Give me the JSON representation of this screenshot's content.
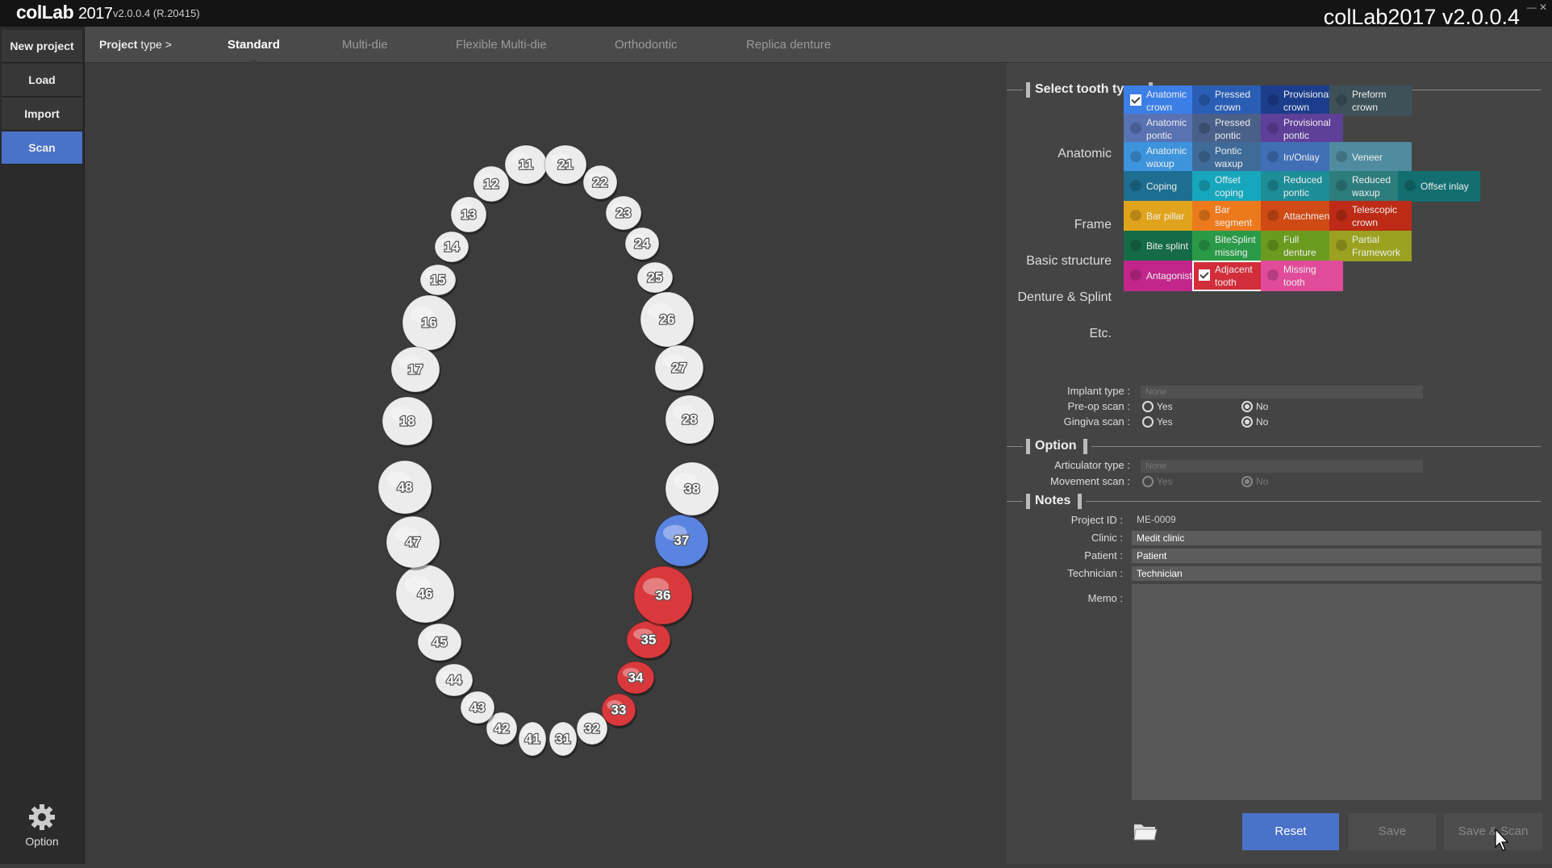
{
  "titlebar": {
    "brand": "colLab",
    "brand_year": "2017",
    "version_small": "v2.0.0.4  (R.20415)",
    "version_large": "colLab2017 v2.0.0.4",
    "controls": "— ✕"
  },
  "sidebar": {
    "new_project": "New project",
    "load": "Load",
    "import": "Import",
    "scan": "Scan",
    "option": "Option"
  },
  "tabs": {
    "project_type_bold": "Project",
    "project_type_rest": " type >",
    "items": [
      "Standard",
      "Multi-die",
      "Flexible Multi-die",
      "Orthodontic",
      "Replica denture"
    ],
    "active": "Standard"
  },
  "teeth": [
    {
      "num": "11",
      "state": "default"
    },
    {
      "num": "12",
      "state": "default"
    },
    {
      "num": "13",
      "state": "default"
    },
    {
      "num": "14",
      "state": "default"
    },
    {
      "num": "15",
      "state": "default"
    },
    {
      "num": "16",
      "state": "default"
    },
    {
      "num": "17",
      "state": "default"
    },
    {
      "num": "18",
      "state": "default"
    },
    {
      "num": "21",
      "state": "default"
    },
    {
      "num": "22",
      "state": "default"
    },
    {
      "num": "23",
      "state": "default"
    },
    {
      "num": "24",
      "state": "default"
    },
    {
      "num": "25",
      "state": "default"
    },
    {
      "num": "26",
      "state": "default"
    },
    {
      "num": "27",
      "state": "default"
    },
    {
      "num": "28",
      "state": "default"
    },
    {
      "num": "31",
      "state": "default"
    },
    {
      "num": "32",
      "state": "default"
    },
    {
      "num": "33",
      "state": "adjacent"
    },
    {
      "num": "34",
      "state": "adjacent"
    },
    {
      "num": "35",
      "state": "adjacent"
    },
    {
      "num": "36",
      "state": "adjacent"
    },
    {
      "num": "37",
      "state": "crown"
    },
    {
      "num": "38",
      "state": "default"
    },
    {
      "num": "41",
      "state": "default"
    },
    {
      "num": "42",
      "state": "default"
    },
    {
      "num": "43",
      "state": "default"
    },
    {
      "num": "44",
      "state": "default"
    },
    {
      "num": "45",
      "state": "default"
    },
    {
      "num": "46",
      "state": "default"
    },
    {
      "num": "47",
      "state": "default"
    },
    {
      "num": "48",
      "state": "default"
    }
  ],
  "tooth_colors": {
    "default": "#ececec",
    "crown": "#5b84e0",
    "adjacent": "#d9393c"
  },
  "select_tooth_type": {
    "title": "Select tooth type",
    "rows": [
      {
        "label": "Anatomic",
        "buttons": [
          {
            "l1": "Anatomic",
            "l2": "crown",
            "color": "#3b7fe6",
            "checked": true
          },
          {
            "l1": "Pressed",
            "l2": "crown",
            "color": "#2a5eb5",
            "checked": false
          },
          {
            "l1": "Provisional",
            "l2": "crown",
            "color": "#1c3d8c",
            "checked": false
          },
          {
            "l1": "Preform",
            "l2": "crown",
            "color": "#3e5159",
            "checked": false
          },
          {
            "l1": "Anatomic",
            "l2": "pontic",
            "color": "#5872b2",
            "checked": false
          },
          {
            "l1": "Pressed",
            "l2": "pontic",
            "color": "#4a6088",
            "checked": false
          },
          {
            "l1": "Provisional",
            "l2": "pontic",
            "color": "#5e4098",
            "checked": false
          },
          {
            "l1": "Anatomic",
            "l2": "waxup",
            "color": "#3d94dc",
            "checked": false
          },
          {
            "l1": "Pontic",
            "l2": "waxup",
            "color": "#3f6b99",
            "checked": false
          },
          {
            "l1": "In/Onlay",
            "l2": "",
            "color": "#406fb6",
            "checked": false
          },
          {
            "l1": "Veneer",
            "l2": "",
            "color": "#4f8c9f",
            "checked": false
          }
        ]
      },
      {
        "label": "Frame",
        "buttons": [
          {
            "l1": "Coping",
            "l2": "",
            "color": "#1d6e90",
            "checked": false
          },
          {
            "l1": "Offset",
            "l2": "coping",
            "color": "#16a7bc",
            "checked": false
          },
          {
            "l1": "Reduced",
            "l2": "pontic",
            "color": "#1d8d98",
            "checked": false
          },
          {
            "l1": "Reduced",
            "l2": "waxup",
            "color": "#2e7d7d",
            "checked": false
          },
          {
            "l1": "Offset inlay",
            "l2": "",
            "color": "#136e70",
            "checked": false
          }
        ]
      },
      {
        "label": "Basic structure",
        "buttons": [
          {
            "l1": "Bar pillar",
            "l2": "",
            "color": "#e0a41c",
            "checked": false
          },
          {
            "l1": "Bar",
            "l2": "segment",
            "color": "#ec7a1c",
            "checked": false
          },
          {
            "l1": "Attachment",
            "l2": "",
            "color": "#cf4a15",
            "checked": false
          },
          {
            "l1": "Telescopic",
            "l2": "crown",
            "color": "#bd2b16",
            "checked": false
          }
        ]
      },
      {
        "label": "Denture & Splint",
        "buttons": [
          {
            "l1": "Bite splint",
            "l2": "",
            "color": "#156b46",
            "checked": false
          },
          {
            "l1": "BiteSplint",
            "l2": "missing",
            "color": "#2b9a48",
            "checked": false
          },
          {
            "l1": "Full",
            "l2": "denture",
            "color": "#6a9b1f",
            "checked": false
          },
          {
            "l1": "Partial",
            "l2": "Framework",
            "color": "#9aa220",
            "checked": false
          }
        ]
      },
      {
        "label": "Etc.",
        "buttons": [
          {
            "l1": "Antagonist",
            "l2": "",
            "color": "#c2268a",
            "checked": false
          },
          {
            "l1": "Adjacent",
            "l2": "tooth",
            "color": "#d12d3a",
            "checked": true
          },
          {
            "l1": "Missing",
            "l2": "tooth",
            "color": "#e04b9a",
            "checked": false
          }
        ]
      }
    ]
  },
  "implant": {
    "type_label": "Implant type :",
    "type_value": "None"
  },
  "preop": {
    "label": "Pre-op scan :",
    "yes": "Yes",
    "no": "No",
    "selected": "No"
  },
  "gingiva": {
    "label": "Gingiva scan :",
    "yes": "Yes",
    "no": "No",
    "selected": "No"
  },
  "option_section": {
    "title": "Option",
    "articulator_label": "Articulator type :",
    "articulator_value": "None",
    "movement_label": "Movement scan :",
    "yes": "Yes",
    "no": "No",
    "selected": "No"
  },
  "notes": {
    "title": "Notes",
    "project_id_label": "Project ID :",
    "project_id": "ME-0009",
    "clinic_label": "Clinic :",
    "clinic": "Medit clinic",
    "patient_label": "Patient :",
    "patient": "Patient",
    "technician_label": "Technician :",
    "technician": "Technician",
    "memo_label": "Memo :"
  },
  "actions": {
    "reset": "Reset",
    "save": "Save",
    "save_scan": "Save & Scan"
  }
}
